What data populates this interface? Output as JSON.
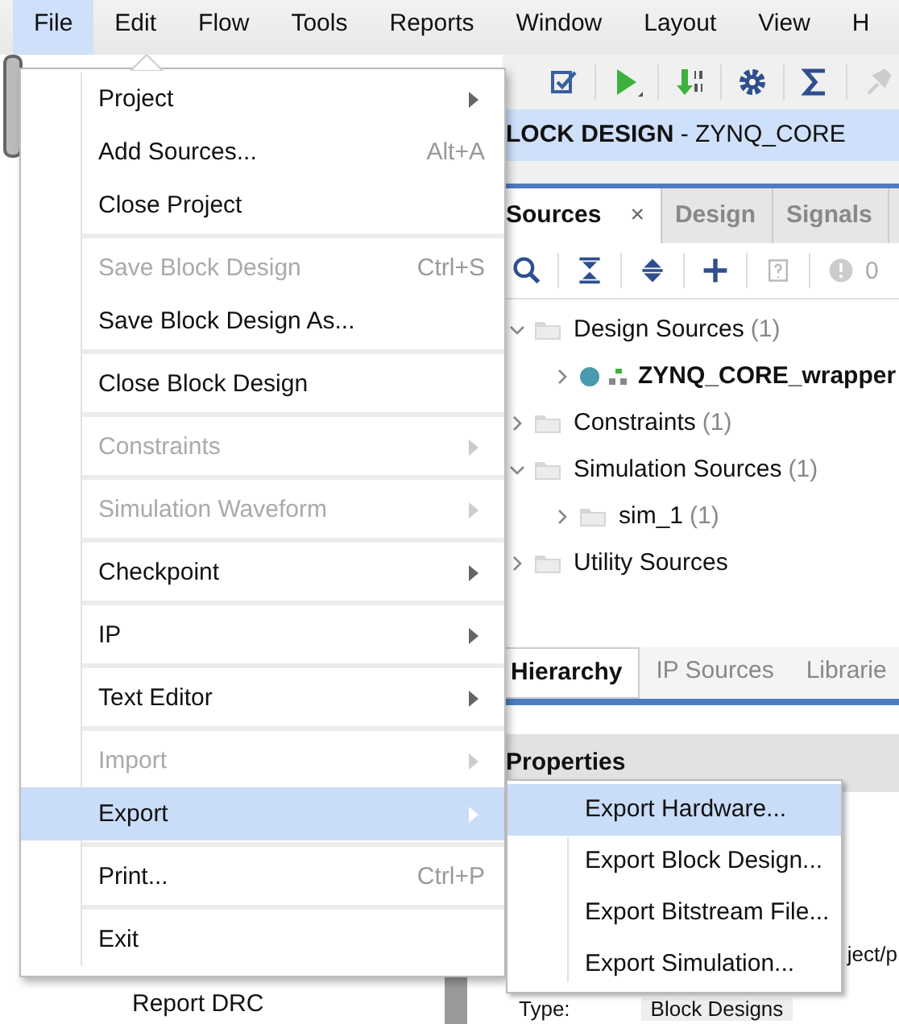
{
  "menubar": [
    {
      "label": "File",
      "selected": true
    },
    {
      "label": "Edit",
      "selected": false
    },
    {
      "label": "Flow",
      "selected": false
    },
    {
      "label": "Tools",
      "selected": false
    },
    {
      "label": "Reports",
      "selected": false
    },
    {
      "label": "Window",
      "selected": false
    },
    {
      "label": "Layout",
      "selected": false
    },
    {
      "label": "View",
      "selected": false
    },
    {
      "label": "H",
      "selected": false
    }
  ],
  "header": {
    "title": "**LOCK DESIGN** - ZYNQ_CORE"
  },
  "sources_tabs": [
    {
      "label": "Sources",
      "selected": true,
      "close_label": "×"
    },
    {
      "label": "Design",
      "selected": false
    },
    {
      "label": "Signals",
      "selected": false
    }
  ],
  "sources_toolbar": {
    "badge_count": "0"
  },
  "tree": [
    {
      "kind": "folder",
      "label": "Design Sources",
      "count": "(1)",
      "expanded": true,
      "children": [
        {
          "kind": "module",
          "label": "ZYNQ_CORE_wrapper",
          "expanded": false
        }
      ]
    },
    {
      "kind": "folder",
      "label": "Constraints",
      "count": "(1)",
      "expanded": false
    },
    {
      "kind": "folder",
      "label": "Simulation Sources",
      "count": "(1)",
      "expanded": true,
      "children": [
        {
          "kind": "folder",
          "label": "sim_1",
          "count": "(1)",
          "expanded": false
        }
      ]
    },
    {
      "kind": "folder",
      "label": "Utility Sources",
      "expanded": false
    }
  ],
  "bottom_tabs": [
    {
      "label": "Hierarchy",
      "selected": true
    },
    {
      "label": "IP Sources",
      "selected": false
    },
    {
      "label": "Librarie",
      "selected": false
    }
  ],
  "properties": {
    "title": "Properties",
    "path_fragment": "ject/p",
    "type_label": "Type:",
    "type_value": "Block Designs"
  },
  "flow_navigator": {
    "item": "Report DRC"
  },
  "file_menu": [
    {
      "label": "Project",
      "submenu": true,
      "disabled": false,
      "selected": false,
      "separator_before": false
    },
    {
      "label": "Add Sources...",
      "shortcut": "Alt+A",
      "submenu": false,
      "disabled": false,
      "selected": false,
      "separator_before": false
    },
    {
      "label": "Close Project",
      "submenu": false,
      "disabled": false,
      "selected": false,
      "separator_before": false
    },
    {
      "label": "Save Block Design",
      "shortcut": "Ctrl+S",
      "submenu": false,
      "disabled": true,
      "selected": false,
      "separator_before": true
    },
    {
      "label": "Save Block Design As...",
      "submenu": false,
      "disabled": false,
      "selected": false,
      "separator_before": false
    },
    {
      "label": "Close Block Design",
      "submenu": false,
      "disabled": false,
      "selected": false,
      "separator_before": true
    },
    {
      "label": "Constraints",
      "submenu": true,
      "disabled": true,
      "selected": false,
      "separator_before": true
    },
    {
      "label": "Simulation Waveform",
      "submenu": true,
      "disabled": true,
      "selected": false,
      "separator_before": true
    },
    {
      "label": "Checkpoint",
      "submenu": true,
      "disabled": false,
      "selected": false,
      "separator_before": true
    },
    {
      "label": "IP",
      "submenu": true,
      "disabled": false,
      "selected": false,
      "separator_before": true
    },
    {
      "label": "Text Editor",
      "submenu": true,
      "disabled": false,
      "selected": false,
      "separator_before": true
    },
    {
      "label": "Import",
      "submenu": true,
      "disabled": true,
      "selected": false,
      "separator_before": true
    },
    {
      "label": "Export",
      "submenu": true,
      "disabled": false,
      "selected": true,
      "separator_before": false
    },
    {
      "label": "Print...",
      "shortcut": "Ctrl+P",
      "submenu": false,
      "disabled": false,
      "selected": false,
      "separator_before": true
    },
    {
      "label": "Exit",
      "submenu": false,
      "disabled": false,
      "selected": false,
      "separator_before": true
    }
  ],
  "export_submenu": [
    {
      "label": "Export Hardware...",
      "selected": true
    },
    {
      "label": "Export Block Design...",
      "selected": false
    },
    {
      "label": "Export Bitstream File...",
      "selected": false
    },
    {
      "label": "Export Simulation...",
      "selected": false
    }
  ]
}
